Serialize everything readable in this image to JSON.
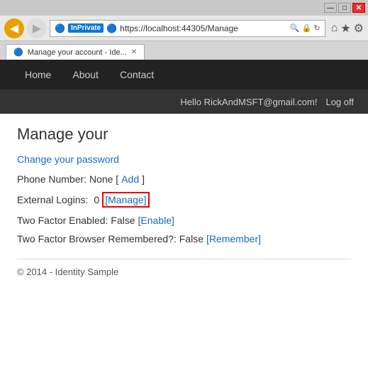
{
  "browser": {
    "title_btns": {
      "minimize": "—",
      "maximize": "□",
      "close": "✕"
    },
    "back_arrow": "◀",
    "forward_arrow": "▶",
    "address": "https://localhost:44305/Manage",
    "inprivate_label": "InPrivate",
    "tab_title": "Manage your account - Ide...",
    "extra_icons": [
      "⌂",
      "★",
      "⚙"
    ]
  },
  "nav": {
    "home": "Home",
    "about": "About",
    "contact": "Contact"
  },
  "userbar": {
    "hello": "Hello RickAndMSFT@gmail.com!",
    "logoff": "Log off"
  },
  "main": {
    "title": "Manage your",
    "change_password": "Change your password",
    "phone_label": "Phone Number: None [",
    "phone_add": "Add",
    "phone_suffix": "]",
    "ext_logins_label": "External Logins:",
    "ext_logins_count": "0",
    "ext_logins_manage": "[Manage]",
    "two_factor_label": "Two Factor Enabled: False",
    "two_factor_enable": "[Enable]",
    "two_factor_browser_label": "Two Factor Browser Remembered?: False",
    "two_factor_remember": "[Remember]"
  },
  "footer": {
    "text": "© 2014 - Identity Sample"
  }
}
